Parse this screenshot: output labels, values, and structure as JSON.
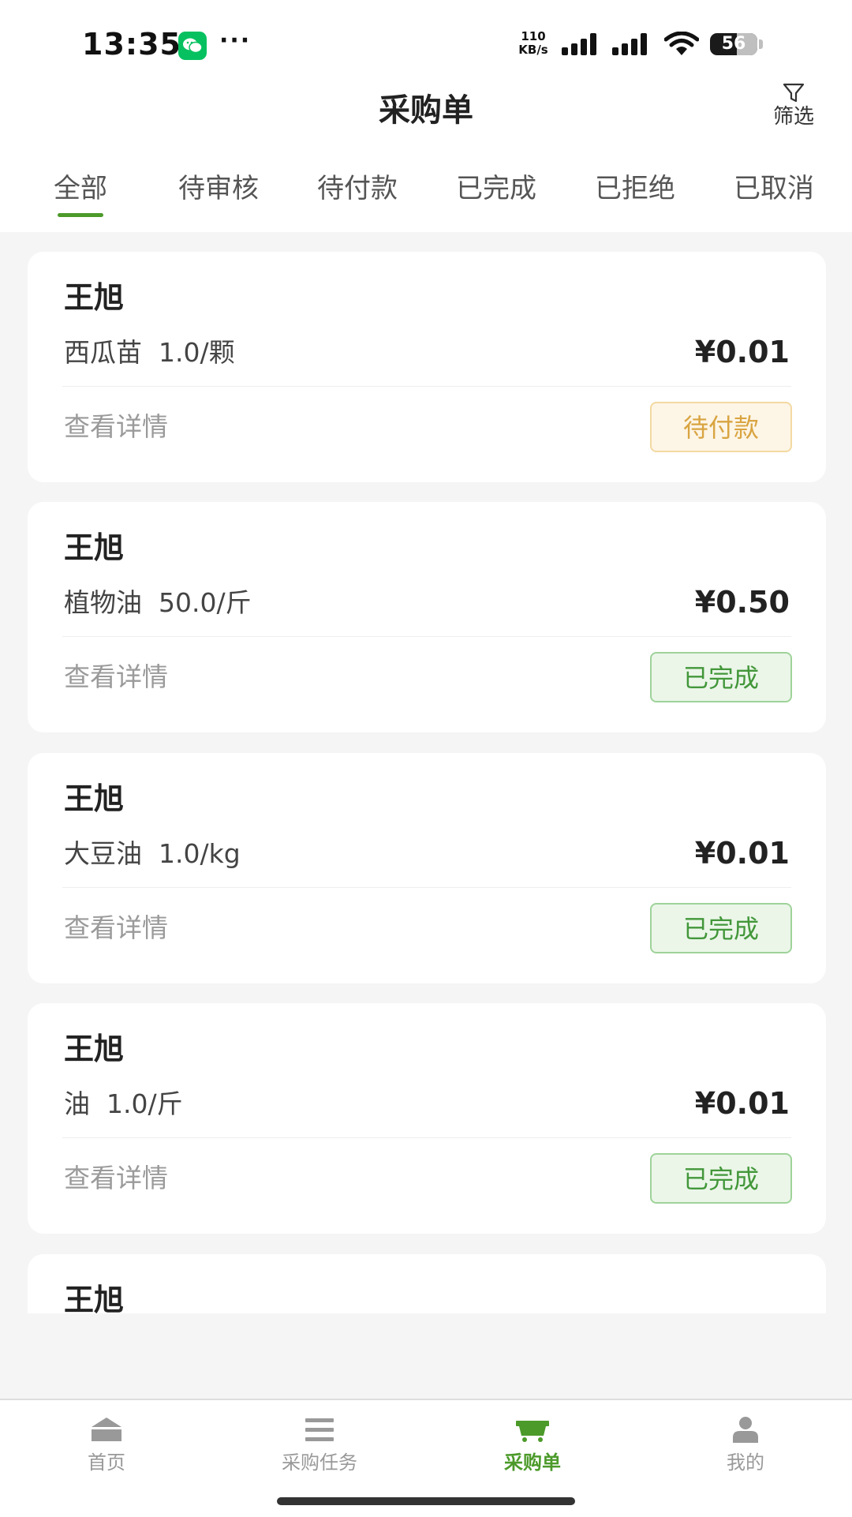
{
  "status_bar": {
    "time": "13:35",
    "more": "···",
    "net_speed_value": "110",
    "net_speed_unit": "KB/s",
    "battery_level": "56",
    "battery_fraction": 0.56
  },
  "header": {
    "title": "采购单",
    "filter_label": "筛选"
  },
  "tabs": [
    {
      "label": "全部",
      "active": true
    },
    {
      "label": "待审核",
      "active": false
    },
    {
      "label": "待付款",
      "active": false
    },
    {
      "label": "已完成",
      "active": false
    },
    {
      "label": "已拒绝",
      "active": false
    },
    {
      "label": "已取消",
      "active": false
    }
  ],
  "orders": [
    {
      "name": "王旭",
      "item": "西瓜苗",
      "quantity": "1.0/颗",
      "price": "¥0.01",
      "details_label": "查看详情",
      "status": "待付款",
      "status_type": "pending"
    },
    {
      "name": "王旭",
      "item": "植物油",
      "quantity": "50.0/斤",
      "price": "¥0.50",
      "details_label": "查看详情",
      "status": "已完成",
      "status_type": "done"
    },
    {
      "name": "王旭",
      "item": "大豆油",
      "quantity": "1.0/kg",
      "price": "¥0.01",
      "details_label": "查看详情",
      "status": "已完成",
      "status_type": "done"
    },
    {
      "name": "王旭",
      "item": "油",
      "quantity": "1.0/斤",
      "price": "¥0.01",
      "details_label": "查看详情",
      "status": "已完成",
      "status_type": "done"
    },
    {
      "name": "王旭"
    }
  ],
  "bottom_nav": [
    {
      "label": "首页",
      "icon": "home-icon",
      "active": false
    },
    {
      "label": "采购任务",
      "icon": "list-icon",
      "active": false
    },
    {
      "label": "采购单",
      "icon": "cart-icon",
      "active": true
    },
    {
      "label": "我的",
      "icon": "user-icon",
      "active": false
    }
  ],
  "colors": {
    "accent": "#4c9a2a",
    "pending": "#d9a441",
    "done": "#43973a",
    "background": "#f5f5f5"
  }
}
